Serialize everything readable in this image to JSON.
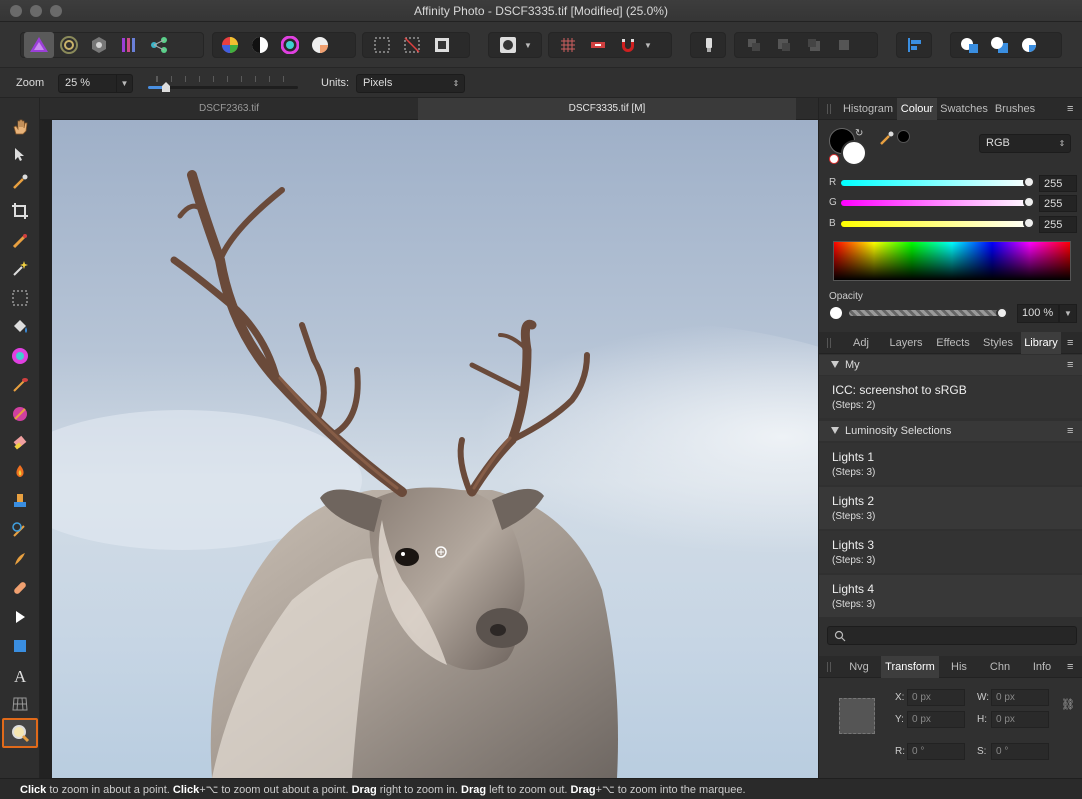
{
  "window": {
    "title": "Affinity Photo - DSCF3335.tif [Modified] (25.0%)"
  },
  "toolbar": {
    "icons": [
      "affinity-photo-persona",
      "liquify-persona",
      "develop-persona",
      "tone-mapping-persona",
      "export-persona",
      "color-wheel",
      "contrast",
      "hue-ring",
      "white-balance",
      "marquee-select",
      "deselect",
      "invert-selection",
      "quick-mask",
      "grid",
      "assistant",
      "snapping",
      "pen",
      "arrange",
      "align",
      "boolean-add",
      "boolean-subtract",
      "boolean-intersect"
    ]
  },
  "context": {
    "zoom_label": "Zoom",
    "zoom_value": "25 %",
    "zoom_fraction": 0.12,
    "units_label": "Units:",
    "units_value": "Pixels"
  },
  "documents": {
    "tabs": [
      {
        "label": "DSCF2363.tif",
        "active": false
      },
      {
        "label": "DSCF3335.tif [M]",
        "active": true
      }
    ]
  },
  "colour_panel": {
    "tabs": [
      "Histogram",
      "Colour",
      "Swatches",
      "Brushes"
    ],
    "active_tab": "Colour",
    "model": "RGB",
    "r_label": "R",
    "r_value": "255",
    "g_label": "G",
    "g_value": "255",
    "b_label": "B",
    "b_value": "255",
    "opacity_label": "Opacity",
    "opacity_value": "100 %",
    "primary_color": "#000000",
    "secondary_color": "#ffffff"
  },
  "library_panel": {
    "tabs": [
      "Adj",
      "Layers",
      "Effects",
      "Styles",
      "Library"
    ],
    "active_tab": "Library",
    "sections": [
      {
        "name": "My",
        "items": [
          {
            "name": "ICC: screenshot to sRGB",
            "steps": "(Steps: 2)"
          }
        ]
      },
      {
        "name": "Luminosity Selections",
        "items": [
          {
            "name": "Lights 1",
            "steps": "(Steps: 3)"
          },
          {
            "name": "Lights 2",
            "steps": "(Steps: 3)"
          },
          {
            "name": "Lights 3",
            "steps": "(Steps: 3)"
          },
          {
            "name": "Lights 4",
            "steps": "(Steps: 3)"
          }
        ]
      }
    ],
    "search_placeholder": ""
  },
  "transform_panel": {
    "tabs": [
      "Nvg",
      "Transform",
      "His",
      "Chn",
      "Info"
    ],
    "active_tab": "Transform",
    "x_label": "X:",
    "x_value": "0 px",
    "y_label": "Y:",
    "y_value": "0 px",
    "w_label": "W:",
    "w_value": "0 px",
    "h_label": "H:",
    "h_value": "0 px",
    "r_label": "R:",
    "r_value": "0 °",
    "s_label": "S:",
    "s_value": "0 °"
  },
  "status": {
    "parts": [
      {
        "bold": true,
        "text": "Click"
      },
      {
        "bold": false,
        "text": " to zoom in about a point. "
      },
      {
        "bold": true,
        "text": "Click"
      },
      {
        "bold": false,
        "text": "+⌥ to zoom out about a point. "
      },
      {
        "bold": true,
        "text": "Drag"
      },
      {
        "bold": false,
        "text": " right to zoom in. "
      },
      {
        "bold": true,
        "text": "Drag"
      },
      {
        "bold": false,
        "text": " left to zoom out. "
      },
      {
        "bold": true,
        "text": "Drag"
      },
      {
        "bold": false,
        "text": "+⌥ to zoom into the marquee."
      }
    ]
  },
  "tools": {
    "items": [
      "hand",
      "move",
      "color-picker",
      "crop",
      "selection-brush",
      "flood-select",
      "marquee",
      "flood-fill",
      "gradient",
      "paint-brush",
      "color-replacement",
      "erase",
      "dodge",
      "clone",
      "undo-brush",
      "smudge",
      "healing",
      "node",
      "rectangle",
      "artistic-text",
      "mesh-warp",
      "zoom"
    ],
    "active": "zoom"
  }
}
